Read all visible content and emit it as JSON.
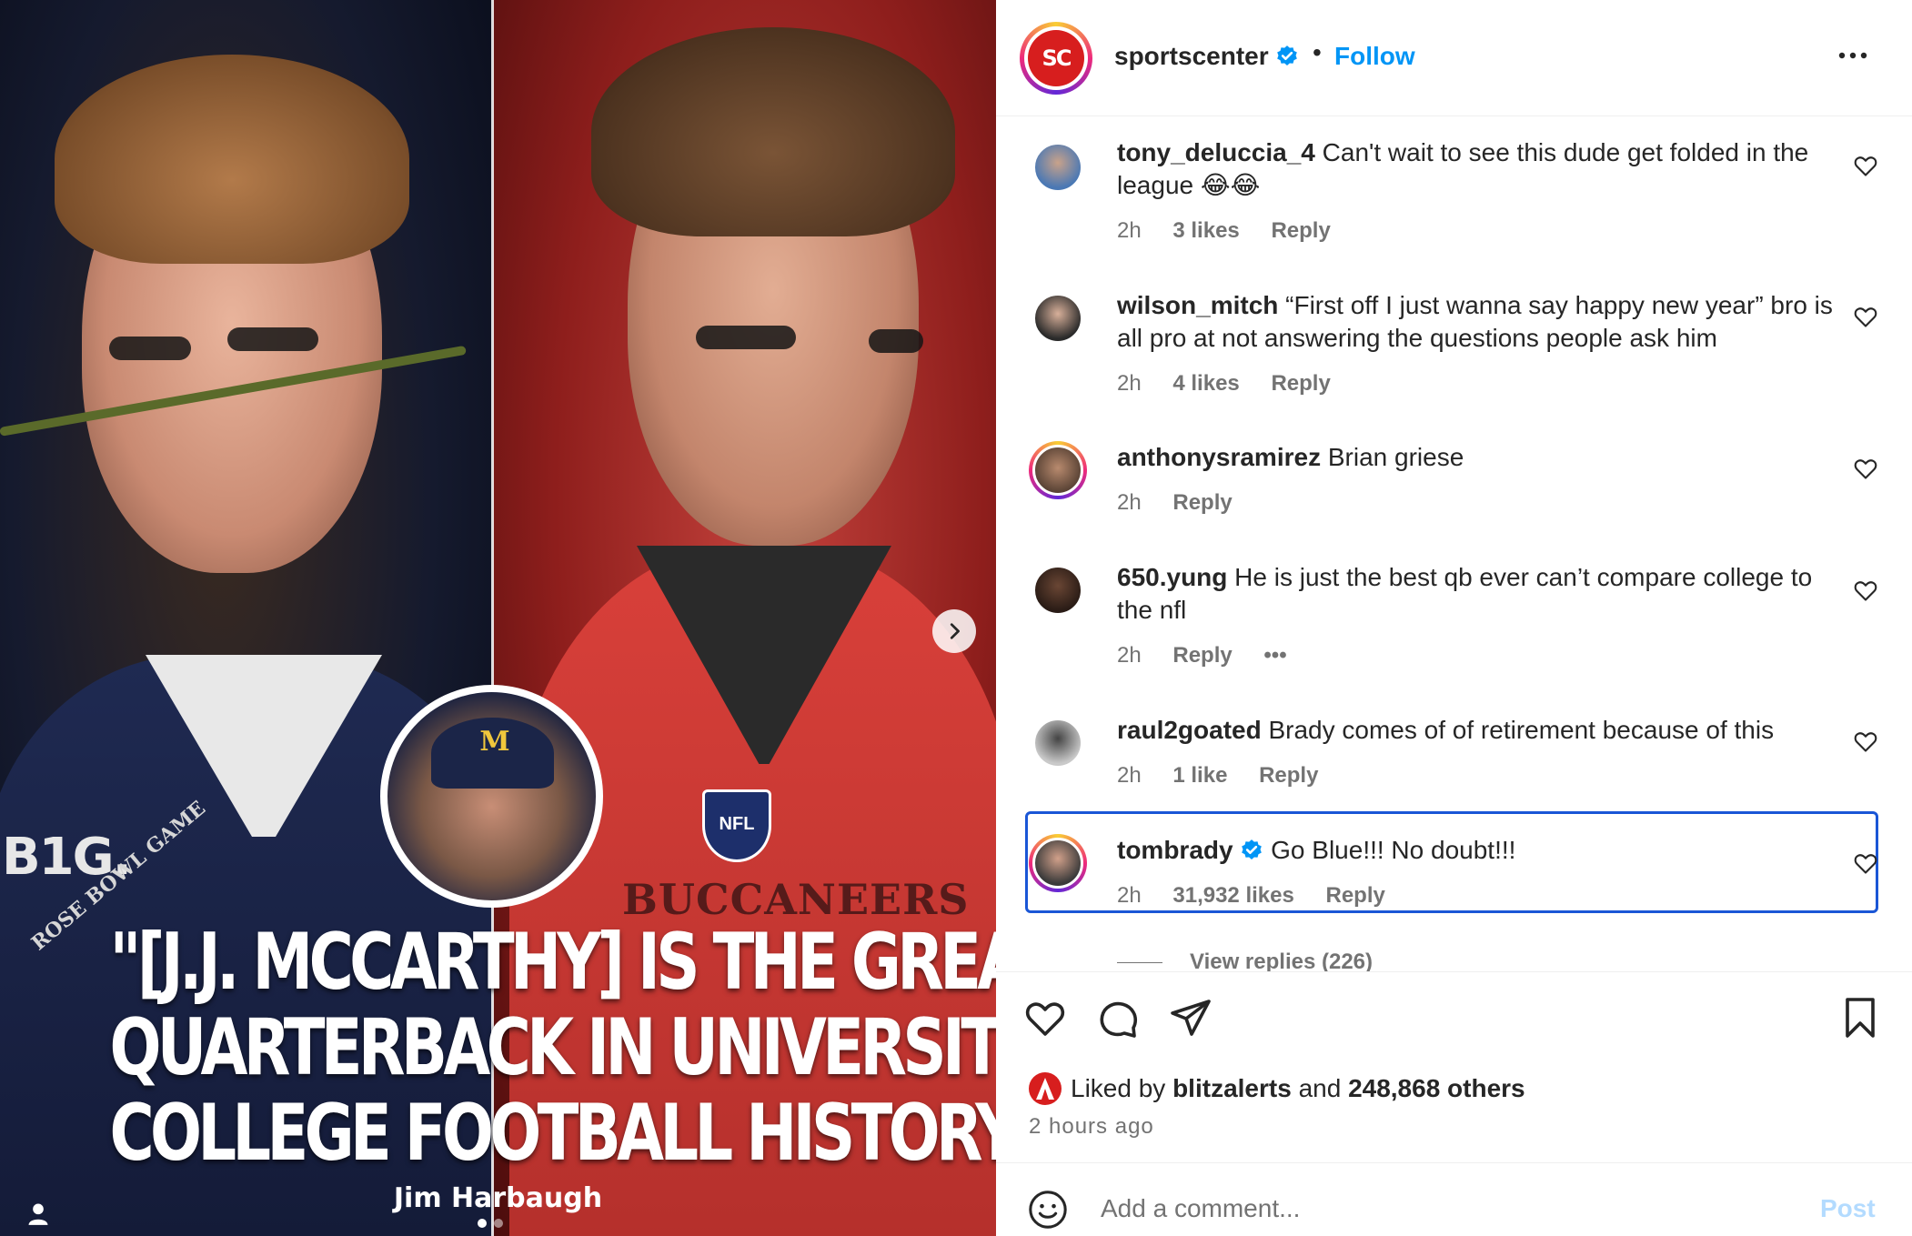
{
  "header": {
    "username": "sportscenter",
    "avatar_text": "SC",
    "separator": "•",
    "follow_label": "Follow"
  },
  "media": {
    "quote_lines": [
      "\"[J.J. MCCARTHY] IS THE GREATEST",
      "QUARTERBACK IN UNIVERSITY OF MICHIGAN",
      "COLLEGE FOOTBALL HISTORY.\""
    ],
    "quote_author": "Jim Harbaugh",
    "badge_big": "B1G.",
    "rose_bowl": "ROSE BOWL GAME",
    "nfl": "NFL",
    "team_text": "BUCCANEERS",
    "cap_letter": "M",
    "carousel": {
      "count": 2,
      "active_index": 0
    }
  },
  "comments": [
    {
      "username": "tony_deluccia_4",
      "text": "Can't wait to see this dude get folded in the league 😂😂",
      "time": "2h",
      "likes": "3 likes",
      "reply": "Reply"
    },
    {
      "username": "wilson_mitch",
      "text": "“First off I just wanna say happy new year” bro is all pro at not answering the questions people ask him",
      "time": "2h",
      "likes": "4 likes",
      "reply": "Reply"
    },
    {
      "username": "anthonysramirez",
      "text": "Brian griese",
      "time": "2h",
      "reply": "Reply"
    },
    {
      "username": "650.yung",
      "text": "He is just the best qb ever can’t compare college to the nfl",
      "time": "2h",
      "reply": "Reply",
      "more": "•••"
    },
    {
      "username": "raul2goated",
      "text": "Brady comes of of retirement because of this",
      "time": "2h",
      "likes": "1 like",
      "reply": "Reply"
    },
    {
      "username": "tombrady",
      "text": "Go Blue!!! No doubt!!!",
      "time": "2h",
      "likes": "31,932 likes",
      "reply": "Reply",
      "verified": true
    }
  ],
  "view_replies": "View replies (226)",
  "likes": {
    "prefix": "Liked by",
    "liker": "blitzalerts",
    "and": "and",
    "count": "248,868 others"
  },
  "post_time": "2 hours ago",
  "comment_box": {
    "placeholder": "Add a comment...",
    "post_label": "Post"
  },
  "colors": {
    "accent": "#0095f6",
    "highlight": "#1a56d6",
    "sc_red": "#d71e1e"
  }
}
